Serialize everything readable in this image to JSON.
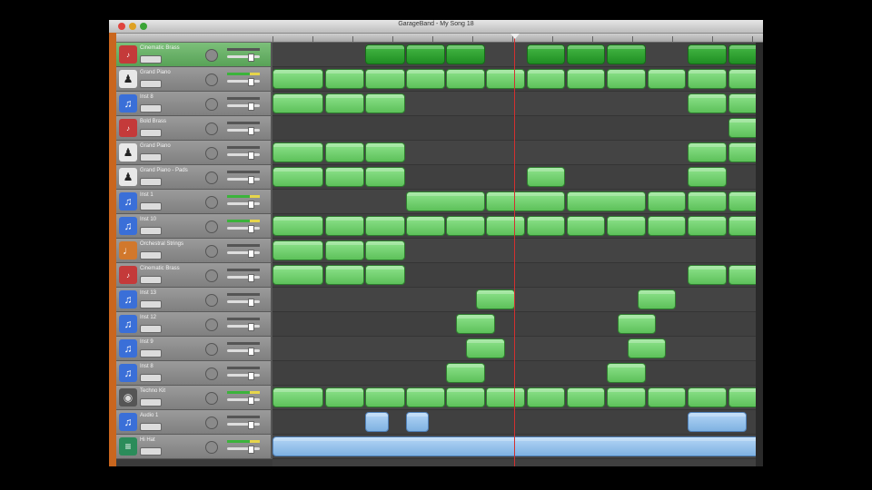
{
  "window": {
    "title": "GarageBand - My Song 18"
  },
  "colors": {
    "region_midi": "#6fd06c",
    "region_selected": "#2aa02d",
    "region_audio": "#8dbde9",
    "playhead": "#d23030",
    "track_selected": "#68b066"
  },
  "tracks": [
    {
      "name": "Cinematic Brass",
      "icon": "brass-icon",
      "selected": true
    },
    {
      "name": "Grand Piano",
      "icon": "piano-icon"
    },
    {
      "name": "Inst 8",
      "icon": "guitar-icon"
    },
    {
      "name": "Bold Brass",
      "icon": "brass-icon"
    },
    {
      "name": "Grand Piano",
      "icon": "piano-icon"
    },
    {
      "name": "Grand Piano - Pads",
      "icon": "piano-icon"
    },
    {
      "name": "Inst 1",
      "icon": "guitar-icon"
    },
    {
      "name": "Inst 10",
      "icon": "guitar-icon"
    },
    {
      "name": "Orchestral Strings",
      "icon": "strings-icon"
    },
    {
      "name": "Cinematic Brass",
      "icon": "brass-icon"
    },
    {
      "name": "Inst 13",
      "icon": "guitar-icon"
    },
    {
      "name": "Inst 12",
      "icon": "guitar-icon"
    },
    {
      "name": "Inst 9",
      "icon": "guitar-icon"
    },
    {
      "name": "Inst 8",
      "icon": "guitar-icon"
    },
    {
      "name": "Techno Kit",
      "icon": "drum-icon"
    },
    {
      "name": "Audio 1",
      "icon": "guitar-icon"
    },
    {
      "name": "Hi Hat",
      "icon": "synth-icon"
    }
  ]
}
